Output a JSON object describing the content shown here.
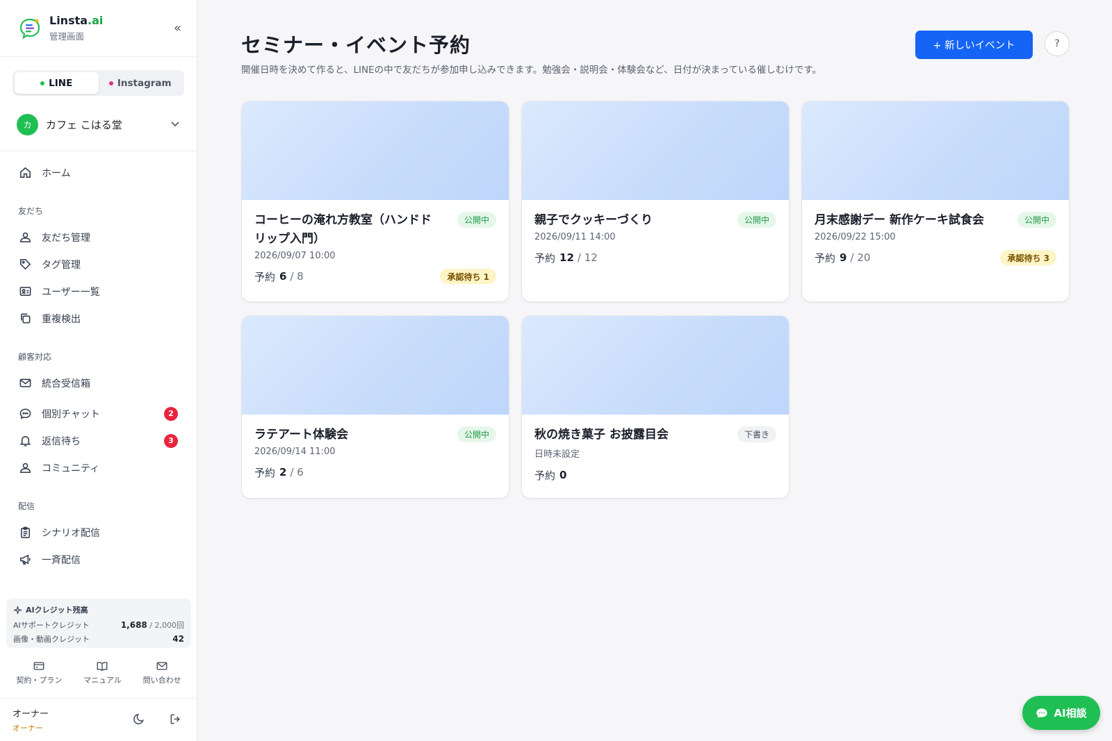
{
  "brand": {
    "name": "Linsta",
    "name_suffix": ".ai",
    "subtitle": "管理画面"
  },
  "channels": [
    {
      "label": "LINE",
      "color": "#1fbf53"
    },
    {
      "label": "Instagram",
      "color": "#d63384"
    }
  ],
  "account": {
    "initial": "カ",
    "name": "カフェ こはる堂"
  },
  "nav": {
    "home": "ホーム",
    "sec_friends": "友だち",
    "friends": "友だち管理",
    "tags": "タグ管理",
    "users": "ユーザー一覧",
    "dupes": "重複検出",
    "sec_support": "顧客対応",
    "inbox": "統合受信箱",
    "chat": "個別チャット",
    "chat_badge": "2",
    "waiting": "返信待ち",
    "waiting_badge": "3",
    "community": "コミュニティ",
    "sec_delivery": "配信",
    "scenario": "シナリオ配信",
    "broadcast": "一斉配信"
  },
  "credits": {
    "title": "AIクレジット残高",
    "support_label": "AIサポートクレジット",
    "support_value": "1,688",
    "support_total": " / 2,000回",
    "media_label": "画像・動画クレジット",
    "media_value": "42"
  },
  "bottom_links": {
    "plan": "契約・プラン",
    "manual": "マニュアル",
    "contact": "問い合わせ"
  },
  "owner": {
    "name": "オーナー",
    "role": "オーナー"
  },
  "page": {
    "title": "セミナー・イベント予約",
    "description": "開催日時を決めて作ると、LINEの中で友だちが参加申し込みできます。勉強会・説明会・体験会など、日付が決まっている催しむけです。",
    "new_button": "+ 新しいイベント",
    "help": "?"
  },
  "reserve_label": "予約",
  "events": [
    {
      "title": "コーヒーの淹れ方教室（ハンドドリップ入門）",
      "status": "公開中",
      "date": "2026/09/07 10:00",
      "booked": "6",
      "capacity": " / 8",
      "pending": "承認待ち 1"
    },
    {
      "title": "親子でクッキーづくり",
      "status": "公開中",
      "date": "2026/09/11 14:00",
      "booked": "12",
      "capacity": " / 12",
      "pending": ""
    },
    {
      "title": "月末感謝デー 新作ケーキ試食会",
      "status": "公開中",
      "date": "2026/09/22 15:00",
      "booked": "9",
      "capacity": " / 20",
      "pending": "承認待ち 3"
    },
    {
      "title": "ラテアート体験会",
      "status": "公開中",
      "date": "2026/09/14 11:00",
      "booked": "2",
      "capacity": " / 6",
      "pending": ""
    },
    {
      "title": "秋の焼き菓子 お披露目会",
      "status": "下書き",
      "date": "日時未設定",
      "booked": "0",
      "capacity": "",
      "pending": ""
    }
  ],
  "ai_button": "AI相談"
}
